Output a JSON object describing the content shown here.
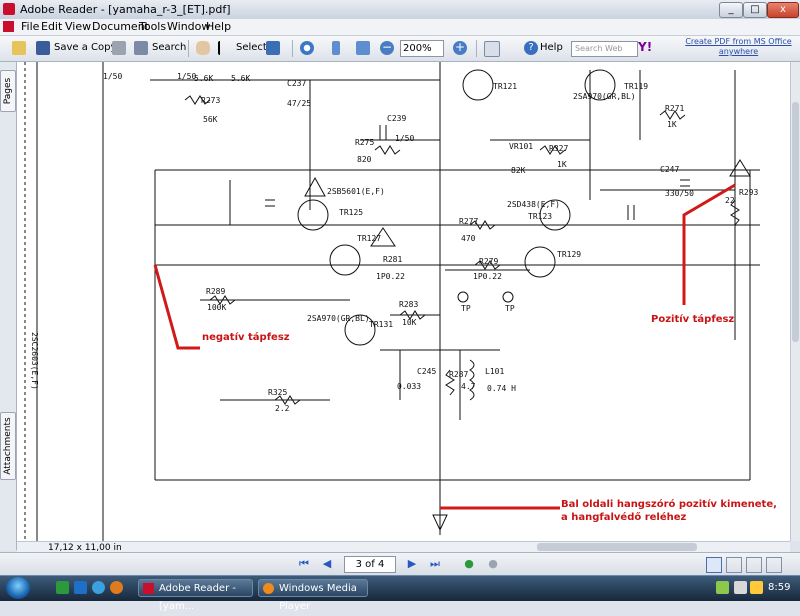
{
  "window": {
    "title": "Adobe Reader - [yamaha_r-3_[ET].pdf]",
    "min": "_",
    "max": "□",
    "close": "x"
  },
  "menu": [
    "File",
    "Edit",
    "View",
    "Document",
    "Tools",
    "Window",
    "Help"
  ],
  "toolbar": {
    "save_copy": "Save a Copy",
    "search": "Search",
    "select": "Select",
    "zoom": "200%",
    "help": "Help",
    "search_web_placeholder": "Search Web",
    "create_pdf": "Create PDF from MS Office anywhere"
  },
  "side_tabs": {
    "pages": "Pages",
    "attachments": "Attachments"
  },
  "document": {
    "annotations": {
      "negative": "negatív tápfesz",
      "positive": "Pozitív tápfesz",
      "output_line1": "Bal oldali hangszóró pozitív kimenete,",
      "output_line2": "a hangfalvédő reléhez"
    },
    "labels": {
      "r273": "R273",
      "r273v": "56K",
      "v56k1": "5.6K",
      "v56k2": "5.6K",
      "c237": "C237",
      "c237v": "47/25",
      "c239": "C239",
      "c239v": "1/50",
      "r275": "R275",
      "r275v": "820",
      "tr121": "TR121",
      "tr119": "TR119",
      "a970": "2SA970(GR,BL)",
      "r271": "R271",
      "r271v": "1K",
      "vr101": "VR101",
      "vr101v": "82K",
      "r327": "R327",
      "r327v": "1K",
      "c247": "C247",
      "c247v": "330/50",
      "r293": "R293",
      "r293v": "22",
      "c5601": "2SB5601(E,F)",
      "tr125": "TR125",
      "d438": "2SD438(E,F)",
      "tr123": "TR123",
      "r277": "R277",
      "r277v": "470",
      "r279": "R279",
      "r279v": "1P0.22",
      "r281": "R281",
      "r281v": "1P0.22",
      "r289": "R289",
      "r289v": "100K",
      "r283": "R283",
      "r283v": "10K",
      "tr127": "TR127",
      "tr129": "TR129",
      "tr131": "TR131",
      "a970b": "2SA970(GR,BL)",
      "r287": "R287",
      "r287v": "4.7",
      "c245": "C245",
      "c245v": "0.033",
      "l101": "L101",
      "l101v": "0.74 H",
      "r325": "R325",
      "r325v": "2.2",
      "c2603": "2SC2603(E,F)",
      "v1_50a": "1/50",
      "v1_50b": "1/50",
      "tp1": "TP",
      "tp2": "TP"
    }
  },
  "status": {
    "page_size": "17,12 x 11,00 in"
  },
  "nav": {
    "page": "3 of 4"
  },
  "taskbar": {
    "app1": "Adobe Reader - [yam...",
    "app2": "Windows Media Player",
    "clock": "8:59"
  }
}
